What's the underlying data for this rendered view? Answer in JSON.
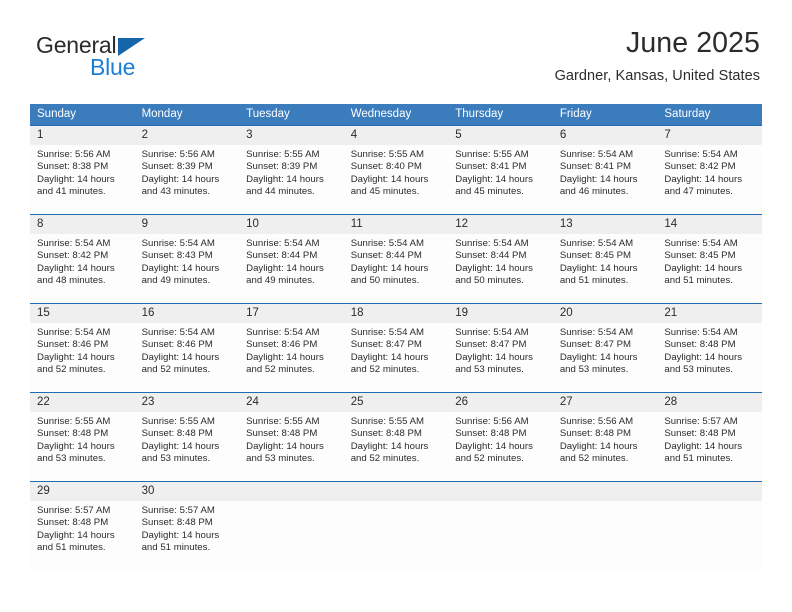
{
  "brand": {
    "name_part1": "General",
    "name_part2": "Blue",
    "logo_icon": "triangle-flag-icon"
  },
  "header": {
    "title": "June 2025",
    "location": "Gardner, Kansas, United States"
  },
  "theme": {
    "header_blue": "#3b7cbd",
    "separator_blue": "#1f6cb0",
    "daynum_gray": "#efefef",
    "text_dark": "#2b2b2b",
    "brand_blue": "#1c7fd6"
  },
  "calendar": {
    "weekday_headers": [
      "Sunday",
      "Monday",
      "Tuesday",
      "Wednesday",
      "Thursday",
      "Friday",
      "Saturday"
    ],
    "weeks": [
      {
        "numbers": [
          "1",
          "2",
          "3",
          "4",
          "5",
          "6",
          "7"
        ],
        "days": [
          {
            "sunrise": "Sunrise: 5:56 AM",
            "sunset": "Sunset: 8:38 PM",
            "daylight1": "Daylight: 14 hours",
            "daylight2": "and 41 minutes."
          },
          {
            "sunrise": "Sunrise: 5:56 AM",
            "sunset": "Sunset: 8:39 PM",
            "daylight1": "Daylight: 14 hours",
            "daylight2": "and 43 minutes."
          },
          {
            "sunrise": "Sunrise: 5:55 AM",
            "sunset": "Sunset: 8:39 PM",
            "daylight1": "Daylight: 14 hours",
            "daylight2": "and 44 minutes."
          },
          {
            "sunrise": "Sunrise: 5:55 AM",
            "sunset": "Sunset: 8:40 PM",
            "daylight1": "Daylight: 14 hours",
            "daylight2": "and 45 minutes."
          },
          {
            "sunrise": "Sunrise: 5:55 AM",
            "sunset": "Sunset: 8:41 PM",
            "daylight1": "Daylight: 14 hours",
            "daylight2": "and 45 minutes."
          },
          {
            "sunrise": "Sunrise: 5:54 AM",
            "sunset": "Sunset: 8:41 PM",
            "daylight1": "Daylight: 14 hours",
            "daylight2": "and 46 minutes."
          },
          {
            "sunrise": "Sunrise: 5:54 AM",
            "sunset": "Sunset: 8:42 PM",
            "daylight1": "Daylight: 14 hours",
            "daylight2": "and 47 minutes."
          }
        ]
      },
      {
        "numbers": [
          "8",
          "9",
          "10",
          "11",
          "12",
          "13",
          "14"
        ],
        "days": [
          {
            "sunrise": "Sunrise: 5:54 AM",
            "sunset": "Sunset: 8:42 PM",
            "daylight1": "Daylight: 14 hours",
            "daylight2": "and 48 minutes."
          },
          {
            "sunrise": "Sunrise: 5:54 AM",
            "sunset": "Sunset: 8:43 PM",
            "daylight1": "Daylight: 14 hours",
            "daylight2": "and 49 minutes."
          },
          {
            "sunrise": "Sunrise: 5:54 AM",
            "sunset": "Sunset: 8:44 PM",
            "daylight1": "Daylight: 14 hours",
            "daylight2": "and 49 minutes."
          },
          {
            "sunrise": "Sunrise: 5:54 AM",
            "sunset": "Sunset: 8:44 PM",
            "daylight1": "Daylight: 14 hours",
            "daylight2": "and 50 minutes."
          },
          {
            "sunrise": "Sunrise: 5:54 AM",
            "sunset": "Sunset: 8:44 PM",
            "daylight1": "Daylight: 14 hours",
            "daylight2": "and 50 minutes."
          },
          {
            "sunrise": "Sunrise: 5:54 AM",
            "sunset": "Sunset: 8:45 PM",
            "daylight1": "Daylight: 14 hours",
            "daylight2": "and 51 minutes."
          },
          {
            "sunrise": "Sunrise: 5:54 AM",
            "sunset": "Sunset: 8:45 PM",
            "daylight1": "Daylight: 14 hours",
            "daylight2": "and 51 minutes."
          }
        ]
      },
      {
        "numbers": [
          "15",
          "16",
          "17",
          "18",
          "19",
          "20",
          "21"
        ],
        "days": [
          {
            "sunrise": "Sunrise: 5:54 AM",
            "sunset": "Sunset: 8:46 PM",
            "daylight1": "Daylight: 14 hours",
            "daylight2": "and 52 minutes."
          },
          {
            "sunrise": "Sunrise: 5:54 AM",
            "sunset": "Sunset: 8:46 PM",
            "daylight1": "Daylight: 14 hours",
            "daylight2": "and 52 minutes."
          },
          {
            "sunrise": "Sunrise: 5:54 AM",
            "sunset": "Sunset: 8:46 PM",
            "daylight1": "Daylight: 14 hours",
            "daylight2": "and 52 minutes."
          },
          {
            "sunrise": "Sunrise: 5:54 AM",
            "sunset": "Sunset: 8:47 PM",
            "daylight1": "Daylight: 14 hours",
            "daylight2": "and 52 minutes."
          },
          {
            "sunrise": "Sunrise: 5:54 AM",
            "sunset": "Sunset: 8:47 PM",
            "daylight1": "Daylight: 14 hours",
            "daylight2": "and 53 minutes."
          },
          {
            "sunrise": "Sunrise: 5:54 AM",
            "sunset": "Sunset: 8:47 PM",
            "daylight1": "Daylight: 14 hours",
            "daylight2": "and 53 minutes."
          },
          {
            "sunrise": "Sunrise: 5:54 AM",
            "sunset": "Sunset: 8:48 PM",
            "daylight1": "Daylight: 14 hours",
            "daylight2": "and 53 minutes."
          }
        ]
      },
      {
        "numbers": [
          "22",
          "23",
          "24",
          "25",
          "26",
          "27",
          "28"
        ],
        "days": [
          {
            "sunrise": "Sunrise: 5:55 AM",
            "sunset": "Sunset: 8:48 PM",
            "daylight1": "Daylight: 14 hours",
            "daylight2": "and 53 minutes."
          },
          {
            "sunrise": "Sunrise: 5:55 AM",
            "sunset": "Sunset: 8:48 PM",
            "daylight1": "Daylight: 14 hours",
            "daylight2": "and 53 minutes."
          },
          {
            "sunrise": "Sunrise: 5:55 AM",
            "sunset": "Sunset: 8:48 PM",
            "daylight1": "Daylight: 14 hours",
            "daylight2": "and 53 minutes."
          },
          {
            "sunrise": "Sunrise: 5:55 AM",
            "sunset": "Sunset: 8:48 PM",
            "daylight1": "Daylight: 14 hours",
            "daylight2": "and 52 minutes."
          },
          {
            "sunrise": "Sunrise: 5:56 AM",
            "sunset": "Sunset: 8:48 PM",
            "daylight1": "Daylight: 14 hours",
            "daylight2": "and 52 minutes."
          },
          {
            "sunrise": "Sunrise: 5:56 AM",
            "sunset": "Sunset: 8:48 PM",
            "daylight1": "Daylight: 14 hours",
            "daylight2": "and 52 minutes."
          },
          {
            "sunrise": "Sunrise: 5:57 AM",
            "sunset": "Sunset: 8:48 PM",
            "daylight1": "Daylight: 14 hours",
            "daylight2": "and 51 minutes."
          }
        ]
      },
      {
        "numbers": [
          "29",
          "30",
          "",
          "",
          "",
          "",
          ""
        ],
        "days": [
          {
            "sunrise": "Sunrise: 5:57 AM",
            "sunset": "Sunset: 8:48 PM",
            "daylight1": "Daylight: 14 hours",
            "daylight2": "and 51 minutes."
          },
          {
            "sunrise": "Sunrise: 5:57 AM",
            "sunset": "Sunset: 8:48 PM",
            "daylight1": "Daylight: 14 hours",
            "daylight2": "and 51 minutes."
          },
          {
            "sunrise": "",
            "sunset": "",
            "daylight1": "",
            "daylight2": ""
          },
          {
            "sunrise": "",
            "sunset": "",
            "daylight1": "",
            "daylight2": ""
          },
          {
            "sunrise": "",
            "sunset": "",
            "daylight1": "",
            "daylight2": ""
          },
          {
            "sunrise": "",
            "sunset": "",
            "daylight1": "",
            "daylight2": ""
          },
          {
            "sunrise": "",
            "sunset": "",
            "daylight1": "",
            "daylight2": ""
          }
        ]
      }
    ]
  }
}
